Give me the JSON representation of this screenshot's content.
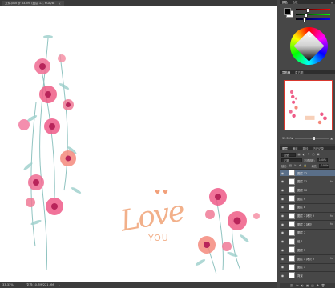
{
  "document": {
    "tab_title": "文件.psd @ 33.3% (图层 12, RGB/8)",
    "close": "×"
  },
  "status": {
    "zoom": "33.33%",
    "doc_info": "文档:10.7M/221.9M",
    "arrow": "›"
  },
  "artwork": {
    "love": "Love",
    "you": "YOU",
    "hearts": "♥ ♥"
  },
  "panels": {
    "color": {
      "tabs": [
        "颜色",
        "色板"
      ]
    },
    "navigator": {
      "tabs": [
        "导航器",
        "直方图"
      ],
      "zoom": "33.33%",
      "zoom_out": "▴",
      "zoom_in": "▲"
    },
    "layers": {
      "tabs": [
        "图层",
        "通道",
        "路径",
        "历史记录"
      ],
      "kind_label": "类型",
      "blend_mode": "正常",
      "opacity_label": "不透明度:",
      "opacity_value": "100%",
      "lock_label": "锁定:",
      "fill_label": "填充:",
      "fill_value": "100%",
      "rows": [
        {
          "name": "图层 12",
          "fx": "",
          "selected": true
        },
        {
          "name": "图层 11",
          "fx": "fx"
        },
        {
          "name": "图层 10",
          "fx": ""
        },
        {
          "name": "图层 9",
          "fx": ""
        },
        {
          "name": "图层 8",
          "fx": ""
        },
        {
          "name": "图层 7 拷贝 2",
          "fx": "fx"
        },
        {
          "name": "图层 7 拷贝",
          "fx": "fx"
        },
        {
          "name": "图层 7",
          "fx": ""
        },
        {
          "name": "组 1",
          "fx": ""
        },
        {
          "name": "图层 5",
          "fx": ""
        },
        {
          "name": "图层 1 拷贝 2",
          "fx": "fx"
        },
        {
          "name": "图层 1",
          "fx": ""
        },
        {
          "name": "背景",
          "fx": ""
        }
      ],
      "footer_icons": [
        "⛓",
        "fx",
        "◐",
        "▣",
        "▤",
        "✚",
        "🗑"
      ]
    }
  },
  "colors": {
    "accent": "#5a6f89",
    "love": "#f2b08a",
    "flower_pink": "#e8457a"
  }
}
